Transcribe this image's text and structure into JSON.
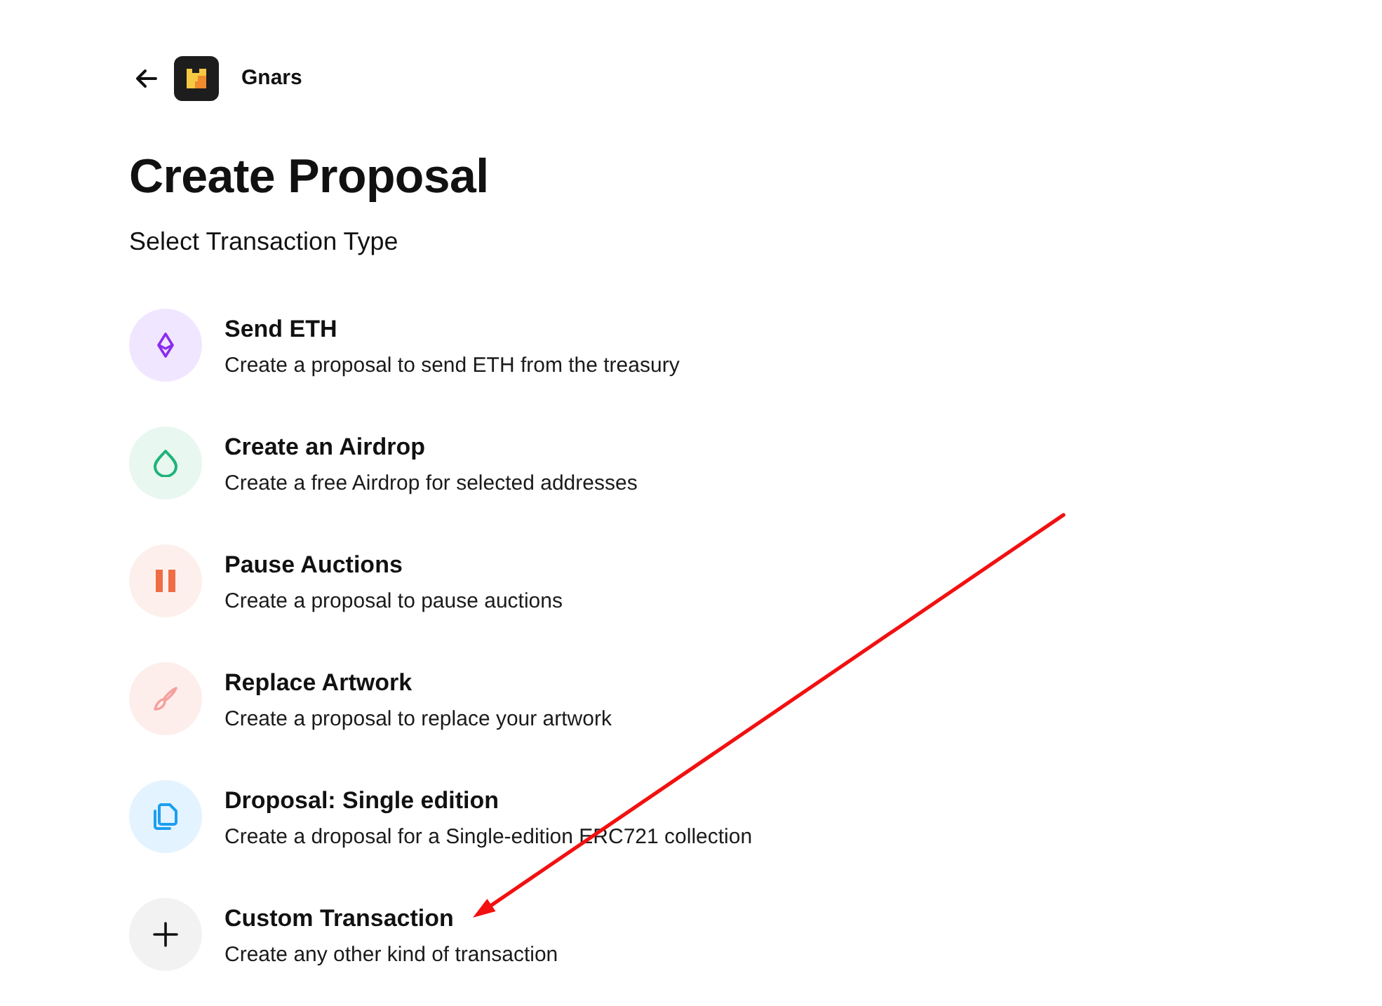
{
  "header": {
    "dao_name": "Gnars"
  },
  "page_title": "Create Proposal",
  "section_title": "Select Transaction Type",
  "options": [
    {
      "kind": "eth",
      "title": "Send ETH",
      "description": "Create a proposal to send ETH from the treasury"
    },
    {
      "kind": "airdrop",
      "title": "Create an Airdrop",
      "description": "Create a free Airdrop for selected addresses"
    },
    {
      "kind": "pause",
      "title": "Pause Auctions",
      "description": "Create a proposal to pause auctions"
    },
    {
      "kind": "artwork",
      "title": "Replace Artwork",
      "description": "Create a proposal to replace your artwork"
    },
    {
      "kind": "droposal",
      "title": "Droposal: Single edition",
      "description": "Create a droposal for a Single-edition ERC721 collection"
    },
    {
      "kind": "custom",
      "title": "Custom Transaction",
      "description": "Create any other kind of transaction"
    }
  ]
}
